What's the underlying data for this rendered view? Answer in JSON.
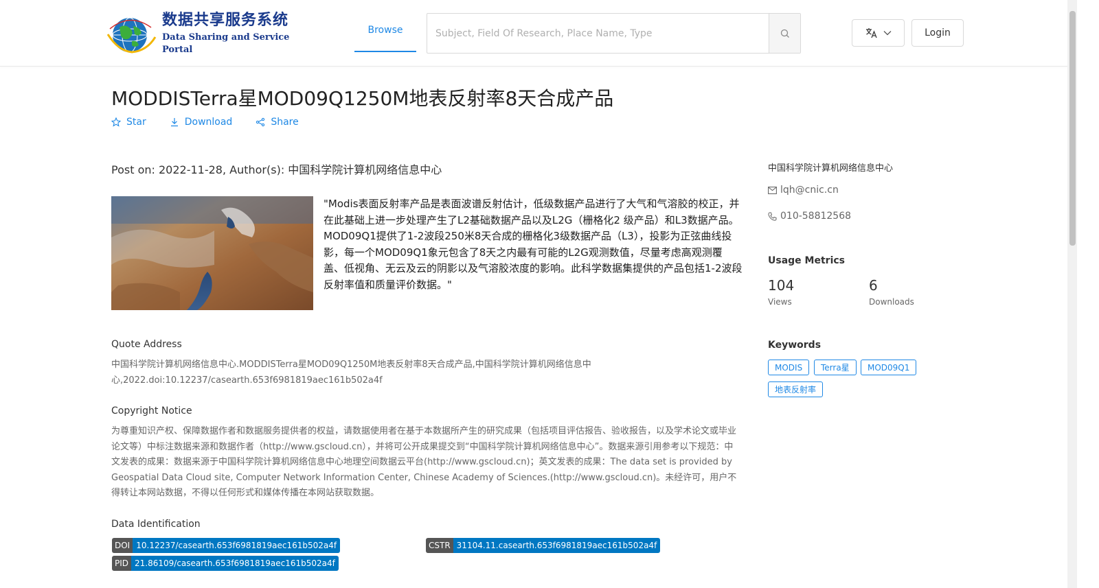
{
  "header": {
    "logo_cn": "数据共享服务系统",
    "logo_en": "Data Sharing and Service Portal",
    "nav_browse": "Browse",
    "search_placeholder": "Subject, Field Of Research, Place Name, Type",
    "login": "Login"
  },
  "dataset": {
    "title": "MODDISTerra星MOD09Q1250M地表反射率8天合成产品",
    "actions": {
      "star": "Star",
      "download": "Download",
      "share": "Share"
    },
    "post_on": "Post on: 2022-11-28, Author(s): 中国科学院计算机网络信息中心",
    "description": "\"Modis表面反射率产品是表面波谱反射估计，低级数据产品进行了大气和气溶胶的校正，并在此基础上进一步处理产生了L2基础数据产品以及L2G（栅格化2 级产品）和L3数据产品。 MOD09Q1提供了1-2波段250米8天合成的栅格化3级数据产品（L3），投影为正弦曲线投影，每一个MOD09Q1象元包含了8天之内最有可能的L2G观测数值，尽量考虑高观测覆盖、低视角、无云及云的阴影以及气溶胶浓度的影响。此科学数据集提供的产品包括1-2波段反射率值和质量评价数据。\""
  },
  "quote": {
    "heading": "Quote Address",
    "text": "中国科学院计算机网络信息中心.MODDISTerra星MOD09Q1250M地表反射率8天合成产品,中国科学院计算机网络信息中心,2022.doi:10.12237/casearth.653f6981819aec161b502a4f"
  },
  "copyright": {
    "heading": "Copyright Notice",
    "text": "为尊重知识产权、保障数据作者和数据服务提供者的权益，请数据使用者在基于本数据所产生的研究成果（包括项目评估报告、验收报告，以及学术论文或毕业论文等）中标注数据来源和数据作者（http://www.gscloud.cn），并将可公开成果提交到“中国科学院计算机网络信息中心”。数据来源引用参考以下规范：中文发表的成果：数据来源于中国科学院计算机网络信息中心地理空间数据云平台(http://www.gscloud.cn)；英文发表的成果：The data set is provided by Geospatial Data Cloud site, Computer Network Information Center, Chinese Academy of Sciences.(http://www.gscloud.cn)。未经许可，用户不得转让本网站数据，不得以任何形式和媒体传播在本网站获取数据。"
  },
  "identification": {
    "heading": "Data Identification",
    "doi_label": "DOI",
    "doi_value": "10.12237/casearth.653f6981819aec161b502a4f",
    "cstr_label": "CSTR",
    "cstr_value": "31104.11.casearth.653f6981819aec161b502a4f",
    "pid_label": "PID",
    "pid_value": "21.86109/casearth.653f6981819aec161b502a4f"
  },
  "sidebar": {
    "org": "中国科学院计算机网络信息中心",
    "email": "lqh@cnic.cn",
    "phone": "010-58812568",
    "usage_heading": "Usage Metrics",
    "views_count": "104",
    "views_label": "Views",
    "downloads_count": "6",
    "downloads_label": "Downloads",
    "keywords_heading": "Keywords",
    "keywords": [
      "MODIS",
      "Terra星",
      "MOD09Q1",
      "地表反射率"
    ]
  },
  "colors": {
    "accent": "#1e88e5",
    "badge_blue": "#0077c2",
    "badge_gray": "#555555"
  }
}
